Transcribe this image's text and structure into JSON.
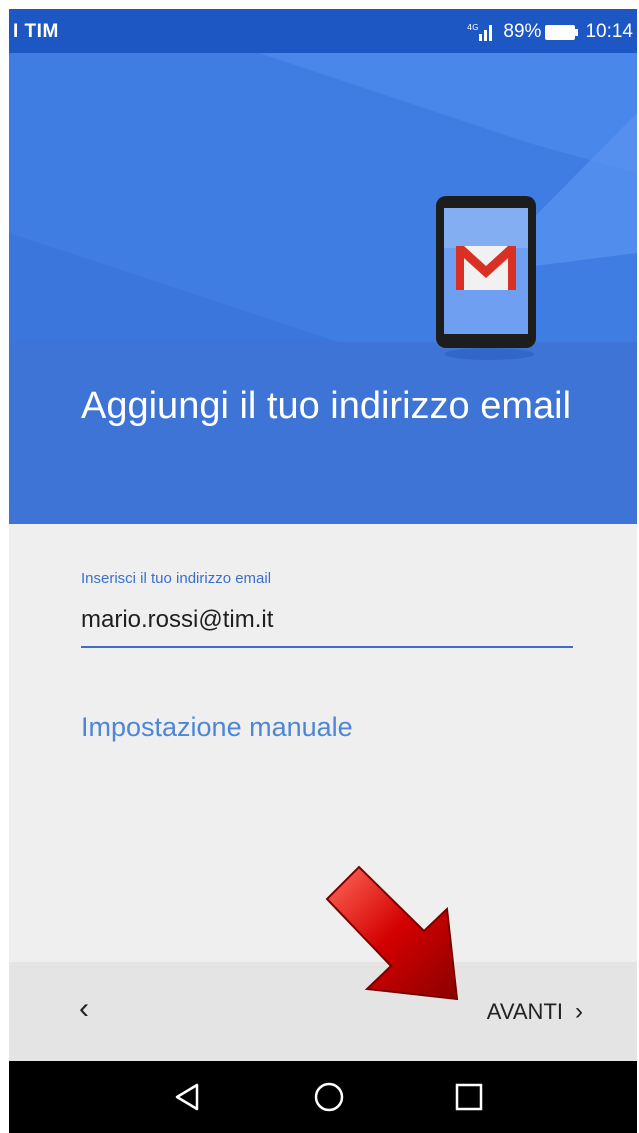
{
  "status_bar": {
    "carrier": "I TIM",
    "battery": "89%",
    "time": "10:14"
  },
  "header": {
    "title": "Aggiungi il tuo indirizzo email",
    "illustration_icon": "gmail-icon"
  },
  "form": {
    "email_label": "Inserisci il tuo indirizzo email",
    "email_value": "mario.rossi@tim.it",
    "manual_setup_link": "Impostazione manuale"
  },
  "action_bar": {
    "back_icon": "chevron-left-icon",
    "back_glyph": "‹",
    "next_label": "AVANTI",
    "next_glyph": "›"
  },
  "nav_bar": {
    "icons": [
      "back-triangle-icon",
      "home-circle-icon",
      "recents-square-icon"
    ]
  },
  "colors": {
    "status_bar": "#1c57c4",
    "hero": "#3f7de3",
    "title_band": "#3d74d6",
    "accent": "#3b6fcd",
    "link": "#4d86d8",
    "annotation_arrow": "#d40000"
  }
}
